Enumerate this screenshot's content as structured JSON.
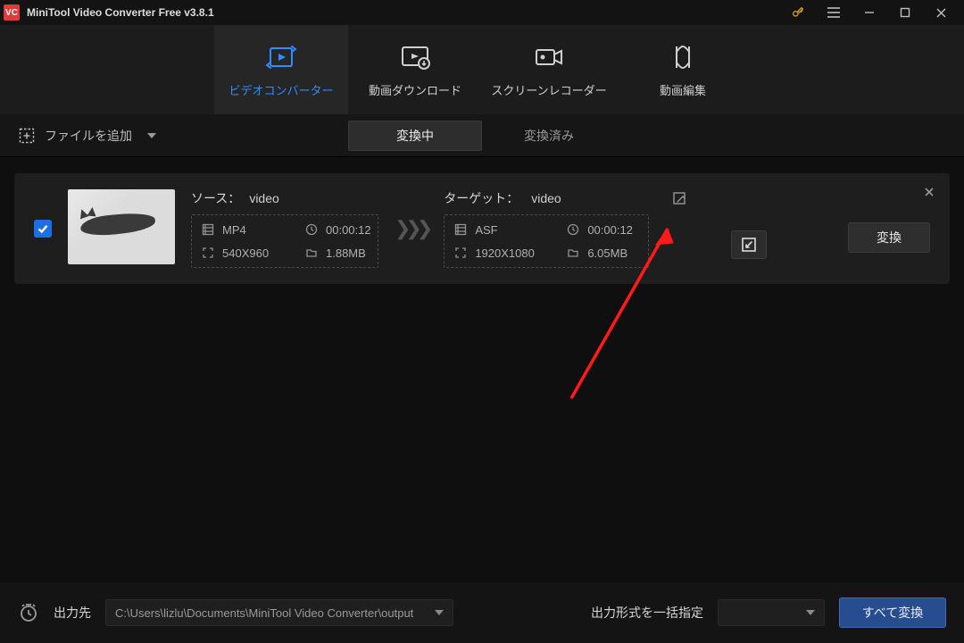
{
  "title": "MiniTool Video Converter Free v3.8.1",
  "tabs": {
    "converter": "ビデオコンバーター",
    "download": "動画ダウンロード",
    "recorder": "スクリーンレコーダー",
    "editor": "動画編集"
  },
  "toolbar": {
    "add_files": "ファイルを追加",
    "seg_converting": "変換中",
    "seg_converted": "変換済み"
  },
  "card": {
    "source_label": "ソース：",
    "source_name": "video",
    "source": {
      "format": "MP4",
      "duration": "00:00:12",
      "resolution": "540X960",
      "size": "1.88MB"
    },
    "target_label": "ターゲット：",
    "target_name": "video",
    "target": {
      "format": "ASF",
      "duration": "00:00:12",
      "resolution": "1920X1080",
      "size": "6.05MB"
    },
    "convert_btn": "変換"
  },
  "footer": {
    "output_label": "出力先",
    "output_path": "C:\\Users\\lizlu\\Documents\\MiniTool Video Converter\\output",
    "output_format_label": "出力形式を一括指定",
    "convert_all": "すべて変換"
  }
}
